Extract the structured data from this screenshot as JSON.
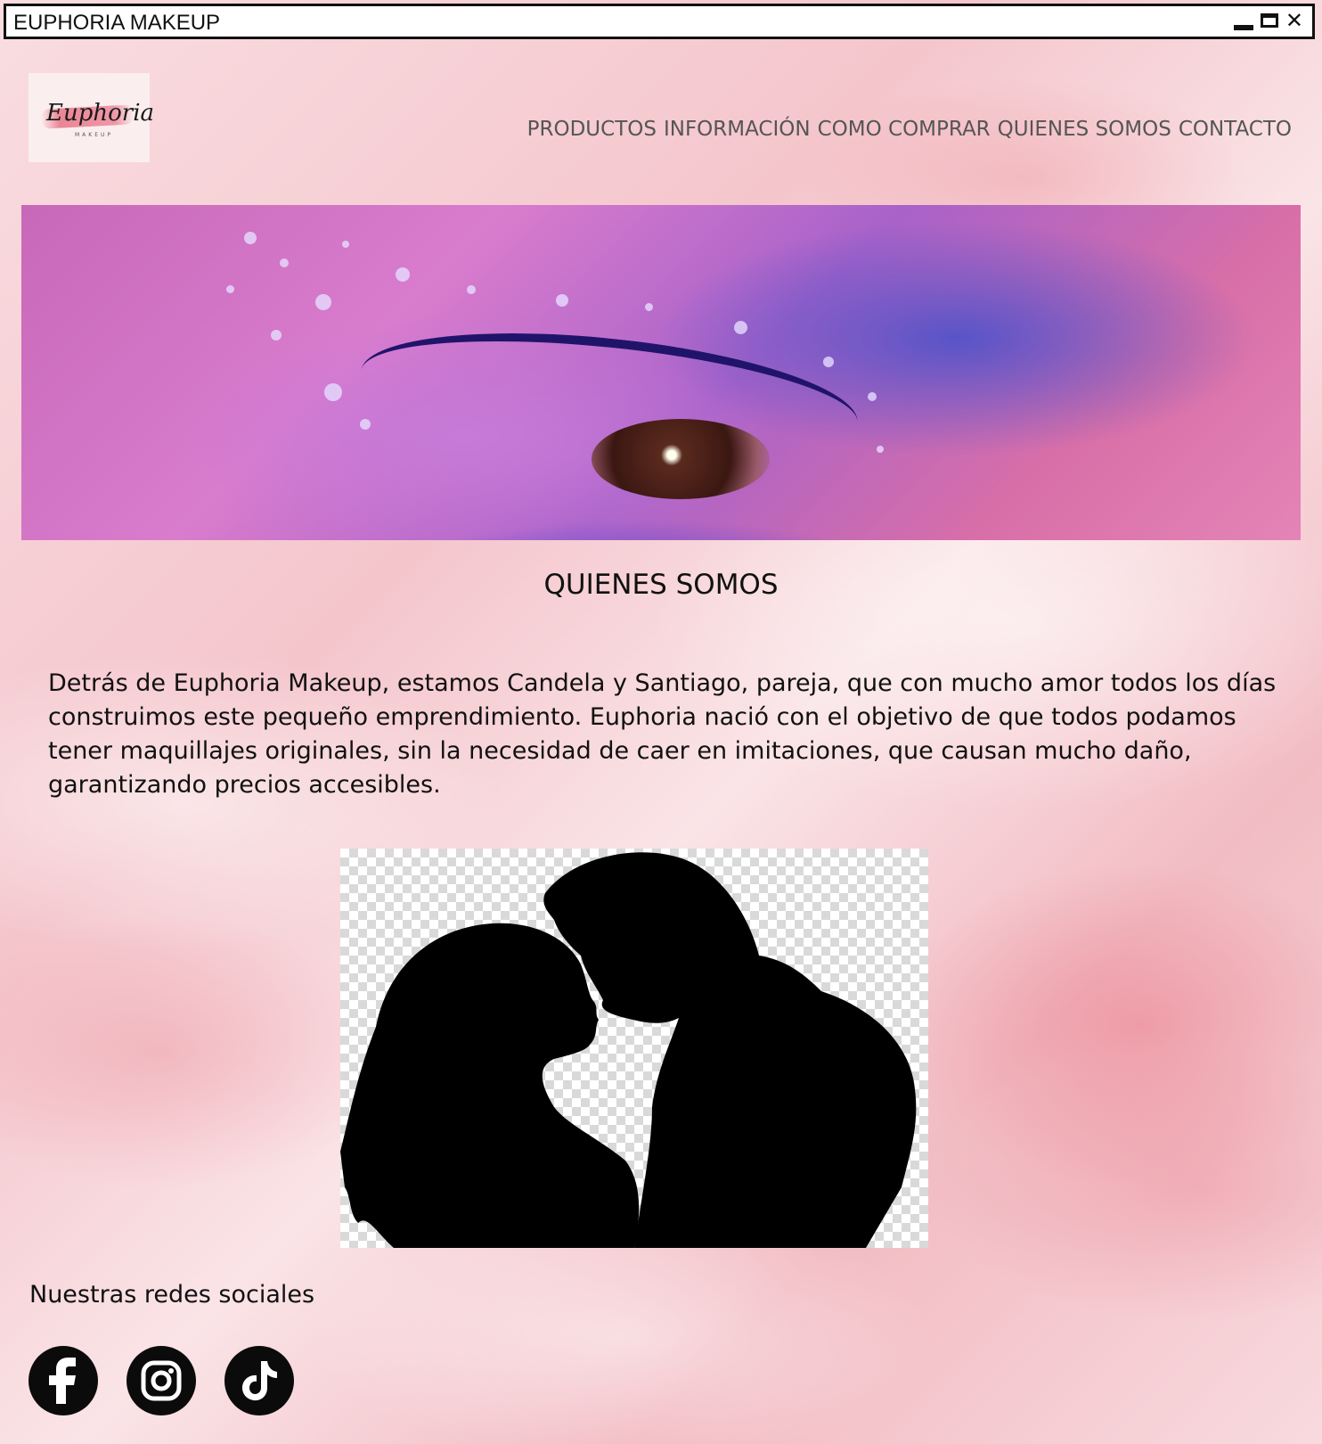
{
  "window": {
    "title": "EUPHORIA MAKEUP"
  },
  "logo": {
    "script_text": "Euphoria",
    "subtext": "MAKEUP"
  },
  "nav": {
    "items": [
      {
        "label": "PRODUCTOS"
      },
      {
        "label": "INFORMACIÓN"
      },
      {
        "label": "COMO COMPRAR"
      },
      {
        "label": "QUIENES SOMOS"
      },
      {
        "label": "CONTACTO"
      }
    ]
  },
  "about": {
    "title": "QUIENES SOMOS",
    "body": "Detrás de Euphoria Makeup, estamos Candela y Santiago, pareja, que con mucho amor todos los días construimos este pequeño emprendimiento. Euphoria nació con el objetivo de que todos podamos tener maquillajes originales, sin la necesidad de caer en imitaciones, que causan mucho daño, garantizando precios accesibles."
  },
  "social": {
    "title": "Nuestras redes sociales",
    "icons": [
      "facebook-icon",
      "instagram-icon",
      "tiktok-icon"
    ]
  },
  "colors": {
    "background": "#f7d6da",
    "text": "#111111",
    "nav_text": "#555555",
    "icon_bg": "#0b0b0b"
  }
}
